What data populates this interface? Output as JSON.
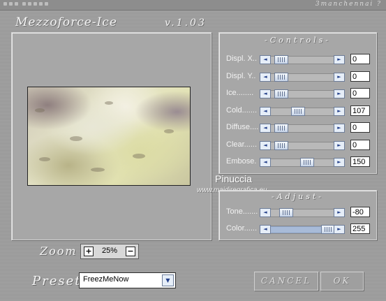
{
  "window": {
    "title": "Mezzoforce-Ice",
    "version": "v.1.03",
    "top_right_text": "3manchennai  ?"
  },
  "controls_panel": {
    "title": "-Controls-",
    "rows": [
      {
        "label": "Displ. X..",
        "value": "0",
        "level": 0.1
      },
      {
        "label": "Displ. Y..",
        "value": "0",
        "level": 0.1
      },
      {
        "label": "Ice........",
        "value": "0",
        "level": 0.1
      },
      {
        "label": "Cold.......",
        "value": "107",
        "level": 0.42
      },
      {
        "label": "Diffuse....",
        "value": "0",
        "level": 0.1
      },
      {
        "label": "Clear......",
        "value": "0",
        "level": 0.1
      },
      {
        "label": "Embose.",
        "value": "150",
        "level": 0.59
      }
    ]
  },
  "adjust_panel": {
    "title": "-Adjust-",
    "rows": [
      {
        "label": "Tone.......",
        "value": "-80",
        "level": 0.19
      },
      {
        "label": "Color......",
        "value": "255",
        "level": 1.0
      }
    ]
  },
  "watermark": {
    "name": "Pinuccia",
    "url": "www.maidiregrafica.eu"
  },
  "zoom": {
    "label": "Zoom",
    "value": "25%",
    "plus": "+",
    "minus": "−"
  },
  "preset": {
    "label": "Preset",
    "value": "FreezMeNow"
  },
  "buttons": {
    "cancel": "CANCEL",
    "ok": "OK"
  },
  "icons": {
    "scroll_left": "◄",
    "scroll_right": "►",
    "dropdown": "▼"
  }
}
